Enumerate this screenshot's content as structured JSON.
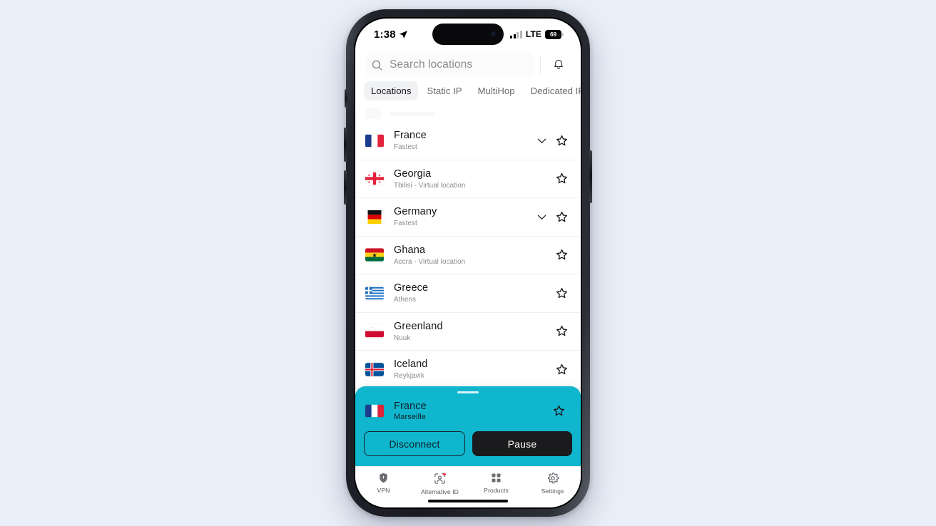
{
  "statusbar": {
    "time": "1:38",
    "location_icon": "location-arrow-icon",
    "signal_icon": "cellular-bars-icon",
    "network": "LTE",
    "battery_level": "69"
  },
  "search": {
    "placeholder": "Search locations",
    "icon": "search-icon",
    "notification_icon": "bell-icon"
  },
  "tabs": [
    {
      "label": "Locations",
      "active": true
    },
    {
      "label": "Static IP",
      "active": false
    },
    {
      "label": "MultiHop",
      "active": false
    },
    {
      "label": "Dedicated IP",
      "active": false
    }
  ],
  "locations": [
    {
      "name": "France",
      "sub": "Fastest",
      "flag": "fr",
      "expandable": true,
      "starred": false
    },
    {
      "name": "Georgia",
      "sub": "Tbilisi - Virtual location",
      "flag": "ge",
      "expandable": false,
      "starred": false
    },
    {
      "name": "Germany",
      "sub": "Fastest",
      "flag": "de",
      "expandable": true,
      "starred": false
    },
    {
      "name": "Ghana",
      "sub": "Accra - Virtual location",
      "flag": "gh",
      "expandable": false,
      "starred": false
    },
    {
      "name": "Greece",
      "sub": "Athens",
      "flag": "gr",
      "expandable": false,
      "starred": false
    },
    {
      "name": "Greenland",
      "sub": "Nuuk",
      "flag": "gl",
      "expandable": false,
      "starred": false
    },
    {
      "name": "Iceland",
      "sub": "Reykjavik",
      "flag": "is",
      "expandable": false,
      "starred": false
    }
  ],
  "connection_panel": {
    "country": "France",
    "city": "Marseille",
    "flag": "fr",
    "star_icon": "star-outline-icon",
    "grabber": "drag-handle",
    "disconnect_label": "Disconnect",
    "pause_label": "Pause",
    "background_color": "#0fb6ce"
  },
  "bottom_tabs": [
    {
      "label": "VPN",
      "icon": "shield-icon",
      "badge": false
    },
    {
      "label": "Alternative ID",
      "icon": "person-scan-icon",
      "badge": true
    },
    {
      "label": "Products",
      "icon": "grid-icon",
      "badge": false
    },
    {
      "label": "Settings",
      "icon": "gear-icon",
      "badge": false
    }
  ],
  "colors": {
    "page_background": "#e9eff8",
    "accent_teal": "#0fb6ce",
    "badge_red": "#f4333d",
    "text_primary": "#17171b",
    "text_secondary": "#8a8a90"
  }
}
